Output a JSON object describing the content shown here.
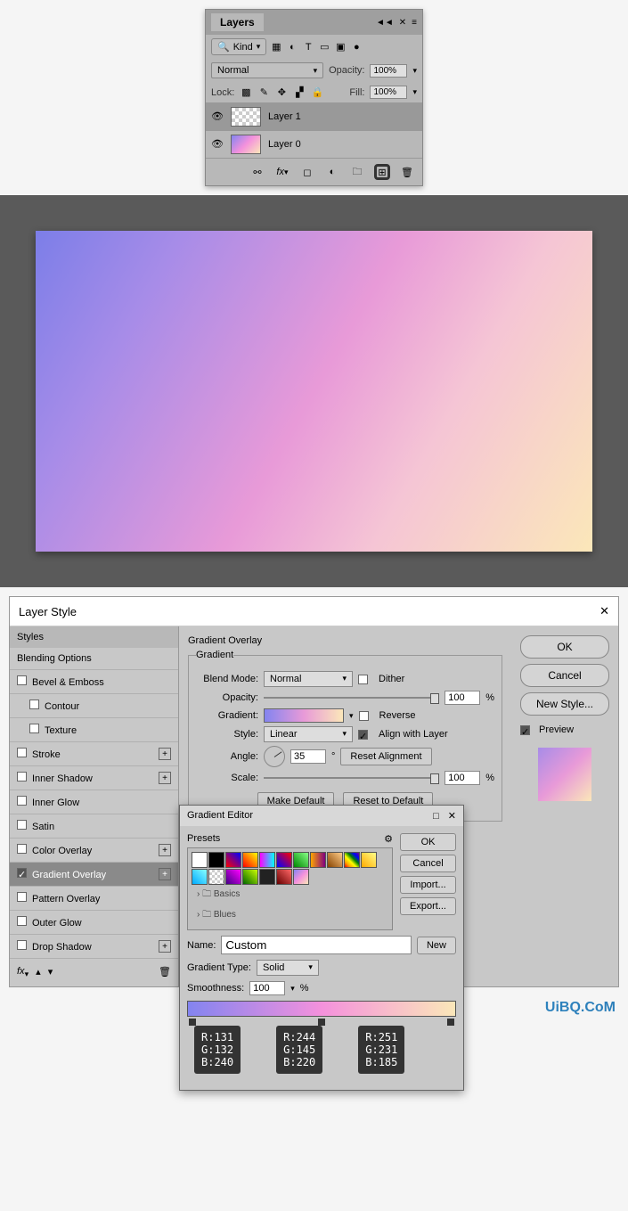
{
  "layers_panel": {
    "title": "Layers",
    "kind_label": "Kind",
    "blend_mode": "Normal",
    "opacity_label": "Opacity:",
    "opacity_value": "100%",
    "lock_label": "Lock:",
    "fill_label": "Fill:",
    "fill_value": "100%",
    "layers": [
      {
        "name": "Layer 1",
        "selected": true,
        "thumb": "trans"
      },
      {
        "name": "Layer 0",
        "selected": false,
        "thumb": "grad"
      }
    ]
  },
  "layer_style": {
    "title": "Layer Style",
    "sidebar_head": "Styles",
    "blending_options": "Blending Options",
    "items": [
      {
        "label": "Bevel & Emboss",
        "checked": false
      },
      {
        "label": "Contour",
        "checked": false,
        "indent": true
      },
      {
        "label": "Texture",
        "checked": false,
        "indent": true
      },
      {
        "label": "Stroke",
        "checked": false,
        "plus": true
      },
      {
        "label": "Inner Shadow",
        "checked": false,
        "plus": true
      },
      {
        "label": "Inner Glow",
        "checked": false
      },
      {
        "label": "Satin",
        "checked": false
      },
      {
        "label": "Color Overlay",
        "checked": false,
        "plus": true
      },
      {
        "label": "Gradient Overlay",
        "checked": true,
        "plus": true,
        "active": true
      },
      {
        "label": "Pattern Overlay",
        "checked": false
      },
      {
        "label": "Outer Glow",
        "checked": false
      },
      {
        "label": "Drop Shadow",
        "checked": false,
        "plus": true
      }
    ],
    "section_title": "Gradient Overlay",
    "subsection": "Gradient",
    "blend_mode_label": "Blend Mode:",
    "blend_mode": "Normal",
    "dither": "Dither",
    "opacity_label": "Opacity:",
    "opacity": "100",
    "pct": "%",
    "gradient_label": "Gradient:",
    "reverse": "Reverse",
    "style_label": "Style:",
    "style": "Linear",
    "align": "Align with Layer",
    "angle_label": "Angle:",
    "angle": "35",
    "deg": "°",
    "reset_align": "Reset Alignment",
    "scale_label": "Scale:",
    "scale": "100",
    "make_default": "Make Default",
    "reset_default": "Reset to Default",
    "ok": "OK",
    "cancel": "Cancel",
    "new_style": "New Style...",
    "preview": "Preview"
  },
  "gradient_editor": {
    "title": "Gradient Editor",
    "presets_label": "Presets",
    "folders": [
      "Basics",
      "Blues"
    ],
    "ok": "OK",
    "cancel": "Cancel",
    "import": "Import...",
    "export": "Export...",
    "name_label": "Name:",
    "name": "Custom",
    "new": "New",
    "type_label": "Gradient Type:",
    "type": "Solid",
    "smooth_label": "Smoothness:",
    "smooth": "100",
    "pct": "%",
    "stops": [
      {
        "r": 131,
        "g": 132,
        "b": 240
      },
      {
        "r": 244,
        "g": 145,
        "b": 220
      },
      {
        "r": 251,
        "g": 231,
        "b": 185
      }
    ]
  },
  "watermark": "UiBQ.CoM"
}
